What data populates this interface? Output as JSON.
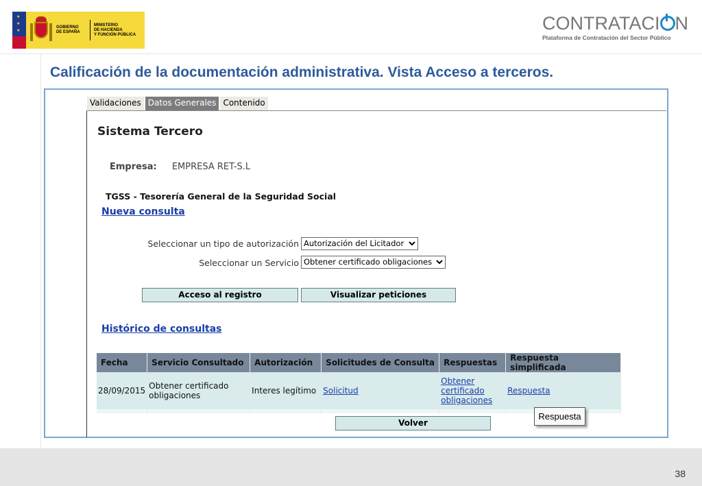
{
  "header": {
    "gov_logo": {
      "left_text": [
        "GOBIERNO",
        "DE ESPAÑA"
      ],
      "right_text": [
        "MINISTERIO",
        "DE HACIENDA",
        "Y FUNCIÓN PÚBLICA"
      ]
    },
    "brand": {
      "word_prefix": "CONTRATACI",
      "word_suffix": "N",
      "subtitle": "Plataforma de Contratación del Sector Público",
      "accent_color": "#1e87c8"
    }
  },
  "slide_title": "Calificación de la documentación administrativa. Vista Acceso a terceros.",
  "tabs": [
    {
      "label": "Validaciones",
      "active": false
    },
    {
      "label": "Datos Generales",
      "active": true
    },
    {
      "label": "Contenido",
      "active": false
    }
  ],
  "main": {
    "title": "Sistema Tercero",
    "empresa_label": "Empresa:",
    "empresa_value": "EMPRESA RET-S.L",
    "section_title": "TGSS - Tesorería General de la Seguridad Social",
    "nueva_consulta": "Nueva consulta",
    "tipo_label": "Seleccionar un tipo de autorización",
    "tipo_value": "Autorización del Licitador",
    "servicio_label": "Seleccionar un Servicio",
    "servicio_value": "Obtener certificado obligaciones",
    "btn_acceso": "Acceso al registro",
    "btn_visualizar": "Visualizar peticiones",
    "historico": "Histórico de consultas",
    "btn_volver": "Volver"
  },
  "table": {
    "headers": [
      "Fecha",
      "Servicio Consultado",
      "Autorización",
      "Solicitudes de Consulta",
      "Respuestas",
      "Respuesta simplificada"
    ],
    "rows": [
      {
        "fecha": "28/09/2015",
        "servicio": [
          "Obtener certificado",
          "obligaciones"
        ],
        "autorizacion": "Interes legítimo",
        "solicitud": "Solicitud",
        "respuestas": [
          "Obtener",
          "certificado",
          "obligaciones"
        ],
        "respuesta_simplificada": "Respuesta"
      }
    ]
  },
  "tooltip": "Respuesta",
  "footer": {
    "page_number": "38"
  }
}
